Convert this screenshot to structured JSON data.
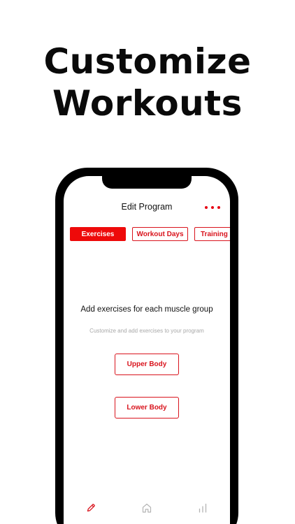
{
  "headline": {
    "line1": "Customize",
    "line2": "Workouts"
  },
  "nav": {
    "title": "Edit Program",
    "more_icon": "more-dots-icon"
  },
  "tabs": [
    {
      "label": "Exercises",
      "active": true
    },
    {
      "label": "Workout Days",
      "active": false
    },
    {
      "label": "Training",
      "active": false
    }
  ],
  "empty_state": {
    "title": "Add exercises for each muscle group",
    "subtitle": "Customize and add exercises to your program"
  },
  "buttons": {
    "upper_body": "Upper Body",
    "lower_body": "Lower Body"
  },
  "tabbar": {
    "items": [
      {
        "icon": "pencil-icon",
        "active": true
      },
      {
        "icon": "home-icon",
        "active": false
      },
      {
        "icon": "bar-chart-icon",
        "active": false
      }
    ]
  },
  "colors": {
    "accent": "#ee0a0a",
    "accent_text": "#d9141d",
    "muted": "#a8a8a8",
    "inactive_icon": "#b3b3b3"
  }
}
